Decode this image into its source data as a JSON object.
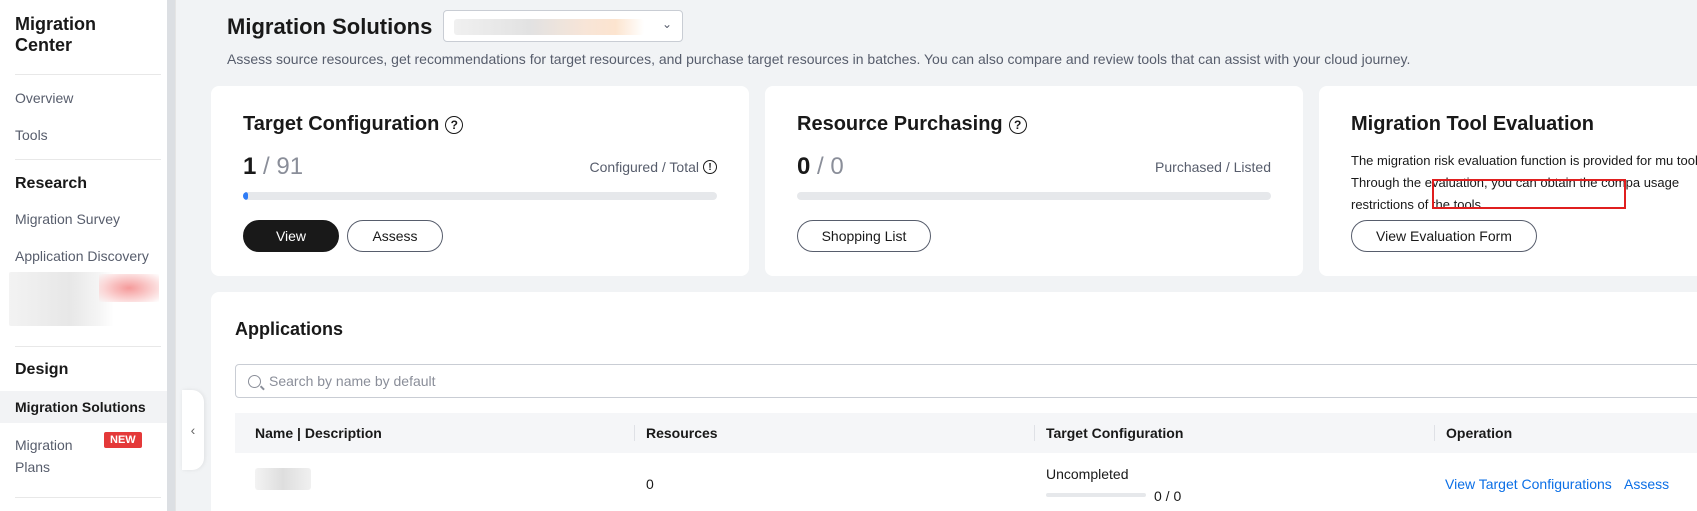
{
  "sidebar": {
    "app_title": "Migration Center",
    "items": {
      "overview": "Overview",
      "tools": "Tools",
      "research_section": "Research",
      "migration_survey": "Migration Survey",
      "application_discovery": "Application Discovery",
      "design_section": "Design",
      "migration_solutions": "Migration Solutions",
      "migration_plans": "Migration Plans",
      "new_badge": "NEW"
    }
  },
  "header": {
    "title": "Migration Solutions",
    "description": "Assess source resources, get recommendations for target resources, and purchase target resources in batches. You can also compare and review tools that can assist with your cloud journey."
  },
  "cards": {
    "target_configuration": {
      "title": "Target Configuration",
      "configured": "1",
      "separator": "/",
      "total": "91",
      "label": "Configured / Total",
      "progress_fraction": 0.011,
      "view_button": "View",
      "assess_button": "Assess"
    },
    "resource_purchasing": {
      "title": "Resource Purchasing",
      "purchased": "0",
      "separator": "/",
      "listed": "0",
      "label": "Purchased / Listed",
      "progress_fraction": 0,
      "shopping_list_button": "Shopping List"
    },
    "migration_tool_evaluation": {
      "title": "Migration Tool Evaluation",
      "description": "The migration risk evaluation function is provided for mu tools. Through the evaluation, you can obtain the compa usage restrictions of the tools.",
      "view_form_button": "View Evaluation Form"
    }
  },
  "applications": {
    "title": "Applications",
    "search_placeholder": "Search by name by default",
    "columns": [
      "Name | Description",
      "Resources",
      "Target Configuration",
      "Operation"
    ],
    "rows": [
      {
        "resources": "0",
        "target_status": "Uncompleted",
        "target_progress": "0 / 0",
        "target_progress_fraction": 0,
        "op_view": "View Target Configurations",
        "op_assess": "Assess"
      }
    ]
  },
  "colors": {
    "accent": "#2e7cf6",
    "link": "#0b6fe6",
    "badge": "#e43939",
    "highlight": "#e01f1f"
  }
}
